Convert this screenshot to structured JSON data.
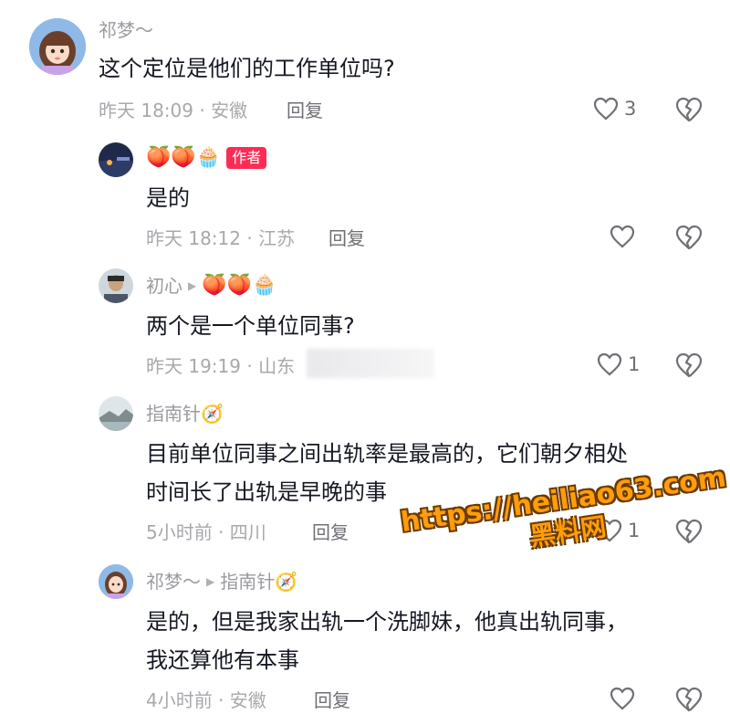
{
  "comments": [
    {
      "name": "祁梦～",
      "text": "这个定位是他们的工作单位吗?",
      "meta": "昨天 18:09 · 安徽",
      "reply": "回复",
      "likes": "3"
    },
    {
      "name": "🍑🍑🧁",
      "badge": "作者",
      "text": "是的",
      "meta": "昨天 18:12 · 江苏",
      "reply": "回复",
      "likes": ""
    },
    {
      "name": "初心",
      "arrow": "▶",
      "reply_to": "🍑🍑🧁",
      "text": "两个是一个单位同事?",
      "meta": "昨天 19:19 · 山东",
      "reply": "回复",
      "likes": "1"
    },
    {
      "name": "指南针🧭",
      "text_line1": "目前单位同事之间出轨率是最高的，它们朝夕相处",
      "text_line2": "时间长了出轨是早晚的事",
      "meta": "5小时前 · 四川",
      "reply": "回复",
      "likes": "1"
    },
    {
      "name": "祁梦～",
      "arrow": "▶",
      "reply_to": "指南针🧭",
      "text_line1": "是的，但是我家出轨一个洗脚妹，他真出轨同事，",
      "text_line2": "我还算他有本事",
      "meta": "4小时前 · 安徽",
      "reply": "回复",
      "likes": ""
    }
  ],
  "watermark": {
    "line1": "https://heiliao63.com",
    "line2": "黑料网"
  },
  "icons": {
    "like": "heart-outline-icon",
    "dislike": "broken-heart-icon"
  }
}
